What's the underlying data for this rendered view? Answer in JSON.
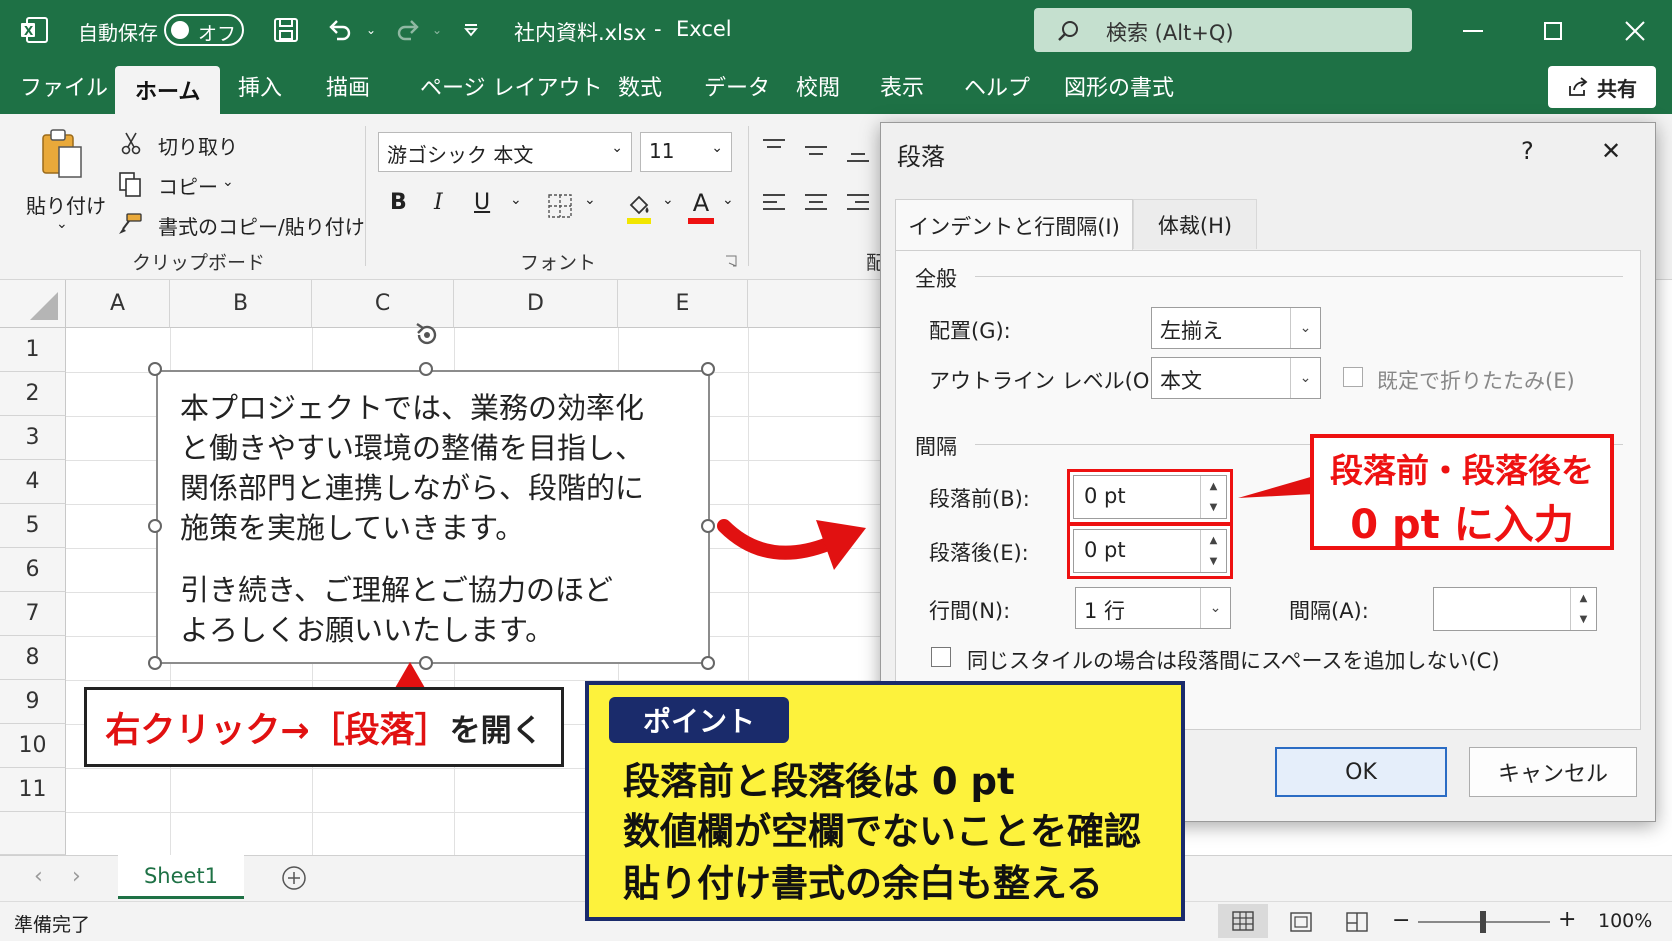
{
  "titlebar": {
    "autosave_label": "自動保存",
    "autosave_state": "オフ",
    "filename": "社内資料.xlsx",
    "separator": "-",
    "app": "Excel",
    "search_placeholder": "検索 (Alt+Q)"
  },
  "tabs": [
    "ファイル",
    "ホーム",
    "挿入",
    "描画",
    "ページ レイアウト",
    "数式",
    "データ",
    "校閲",
    "表示",
    "ヘルプ",
    "図形の書式"
  ],
  "share_label": "共有",
  "ribbon": {
    "paste_label": "貼り付け",
    "cut_label": "切り取り",
    "copy_label": "コピー",
    "format_painter_label": "書式のコピー/貼り付け",
    "clipboard_group": "クリップボード",
    "font_name": "游ゴシック 本文",
    "font_size": "11",
    "font_group": "フォント",
    "bold": "B",
    "italic": "I",
    "underline": "U",
    "font_color_glyph": "A",
    "partial_group": "配"
  },
  "columns": [
    "A",
    "B",
    "C",
    "D",
    "E"
  ],
  "rows": [
    "1",
    "2",
    "3",
    "4",
    "5",
    "6",
    "7",
    "8",
    "9",
    "10",
    "11"
  ],
  "textbox": {
    "line1": "本プロジェクトでは、業務の効率化",
    "line2": "と働きやすい環境の整備を目指し、",
    "line3": "関係部門と連携しながら、段階的に",
    "line4": "施策を実施していきます。",
    "line5": "引き続き、ご理解とご協力のほど",
    "line6": "よろしくお願いいたします。"
  },
  "sheet_tab": "Sheet1",
  "status": {
    "ready": "準備完了",
    "minus": "−",
    "plus": "+",
    "zoom": "100%"
  },
  "dialog": {
    "title": "段落",
    "help": "?",
    "close": "✕",
    "tab_indent": "インデントと行間隔(I)",
    "tab_layout": "体裁(H)",
    "section_general": "全般",
    "alignment_label": "配置(G):",
    "alignment_value": "左揃え",
    "outline_label": "アウトライン レベル(O):",
    "outline_value": "本文",
    "collapsed_label": "既定で折りたたみ(E)",
    "section_spacing": "間隔",
    "before_label": "段落前(B):",
    "before_value": "0 pt",
    "after_label": "段落後(E):",
    "after_value": "0 pt",
    "line_label": "行間(N):",
    "line_value": "1 行",
    "at_label": "間隔(A):",
    "at_value": "",
    "dont_add_label": "同じスタイルの場合は段落間にスペースを追加しない(C)",
    "ok": "OK",
    "cancel": "キャンセル"
  },
  "annotations": {
    "left_red": "右クリック→［段落］",
    "left_black": "を開く",
    "right_line1": "段落前・段落後を",
    "right_line2": "0 pt に入力",
    "point_label": "ポイント",
    "point_line1": "段落前と段落後は 0 pt",
    "point_line2": "数値欄が空欄でないことを確認",
    "point_line3": "貼り付け書式の余白も整える"
  },
  "colors": {
    "excel_green": "#1e7145",
    "callout_red": "#e11111",
    "point_yellow": "#fdf23c",
    "point_navy": "#1a2b6b"
  }
}
